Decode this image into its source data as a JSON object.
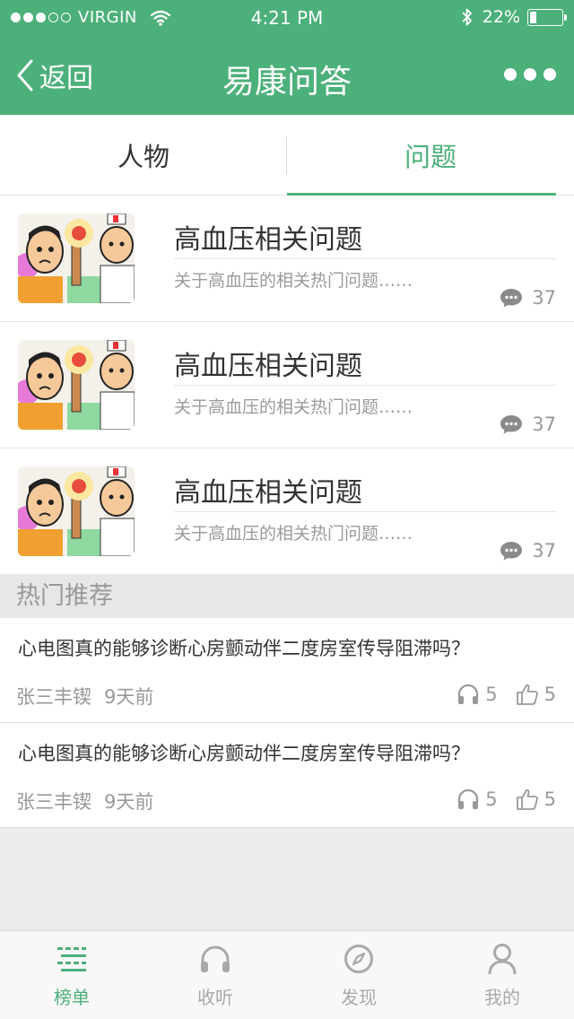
{
  "status_bar": {
    "carrier": "VIRGIN",
    "time": "4:21 PM",
    "battery": "22%",
    "battery_level": 0.22
  },
  "nav": {
    "back_label": "返回",
    "title": "易康问答"
  },
  "tabs": [
    {
      "label": "人物",
      "active": false
    },
    {
      "label": "问题",
      "active": true
    }
  ],
  "topics": [
    {
      "title": "高血压相关问题",
      "desc": "关于高血压的相关热门问题……",
      "count": "37"
    },
    {
      "title": "高血压相关问题",
      "desc": "关于高血压的相关热门问题……",
      "count": "37"
    },
    {
      "title": "高血压相关问题",
      "desc": "关于高血压的相关热门问题……",
      "count": "37"
    }
  ],
  "hot_section": {
    "title": "热门推荐",
    "items": [
      {
        "title": "心电图真的能够诊断心房颤动伴二度房室传导阻滞吗？",
        "author": "张三丰锲",
        "time": "9天前",
        "listens": "5",
        "likes": "5"
      },
      {
        "title": "心电图真的能够诊断心房颤动伴二度房室传导阻滞吗？",
        "author": "张三丰锲",
        "time": "9天前",
        "listens": "5",
        "likes": "5"
      }
    ]
  },
  "tabbar": [
    {
      "label": "榜单",
      "icon": "list-icon",
      "active": true
    },
    {
      "label": "收听",
      "icon": "headphones-icon",
      "active": false
    },
    {
      "label": "发现",
      "icon": "compass-icon",
      "active": false
    },
    {
      "label": "我的",
      "icon": "person-icon",
      "active": false
    }
  ],
  "colors": {
    "brand": "#4cb07a",
    "inactive": "#a9a9a9"
  }
}
